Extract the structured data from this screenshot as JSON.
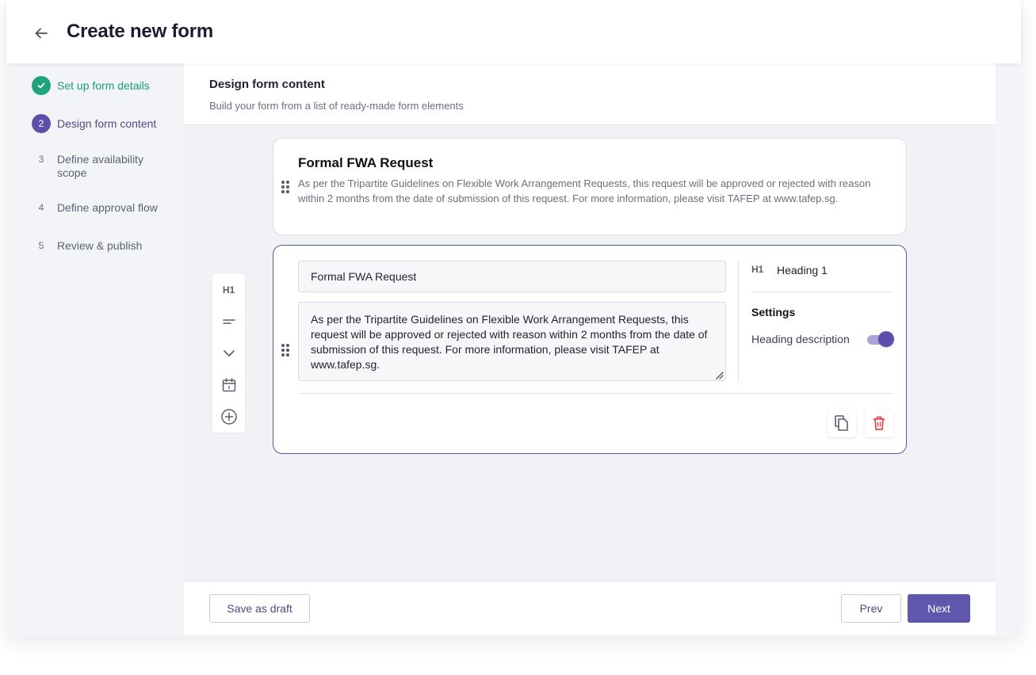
{
  "header": {
    "title": "Create new form",
    "back_icon": "arrow-left-icon"
  },
  "steps": [
    {
      "number": "",
      "label": "Set up form details",
      "state": "done"
    },
    {
      "number": "2",
      "label": "Design form content",
      "state": "active"
    },
    {
      "number": "3",
      "label": "Define availability scope",
      "state": "pending"
    },
    {
      "number": "4",
      "label": "Define approval flow",
      "state": "pending"
    },
    {
      "number": "5",
      "label": "Review & publish",
      "state": "pending"
    }
  ],
  "content_header": {
    "title": "Design form content",
    "subtitle": "Build your form from a list of ready-made form elements"
  },
  "preview_card": {
    "title": "Formal FWA Request",
    "description": "As per the Tripartite Guidelines on Flexible Work Arrangement Requests, this request will be approved or rejected with reason within 2 months from the date of submission of this request. For more information, please visit TAFEP at www.tafep.sg."
  },
  "toolbar": {
    "items": [
      {
        "label": "H1",
        "icon": "heading-icon"
      },
      {
        "label": "",
        "icon": "text-lines-icon"
      },
      {
        "label": "",
        "icon": "chevron-down-icon"
      },
      {
        "label": "",
        "icon": "calendar-icon"
      },
      {
        "label": "",
        "icon": "plus-circle-icon"
      }
    ]
  },
  "edit_card": {
    "title_value": "Formal FWA Request",
    "description_value": "As per the Tripartite Guidelines on Flexible Work Arrangement Requests, this request will be approved or rejected with reason within 2 months from the date of submission of this request. For more information, please visit TAFEP at www.tafep.sg.",
    "element_type_badge": "H1",
    "element_type_label": "Heading 1",
    "settings_label": "Settings",
    "toggle_label": "Heading description",
    "toggle_on": true
  },
  "footer": {
    "save_draft": "Save as draft",
    "prev": "Prev",
    "next": "Next"
  },
  "colors": {
    "accent": "#5f56ad",
    "success": "#1fa37a",
    "danger": "#e0474c",
    "border_active": "#5a56a3"
  }
}
